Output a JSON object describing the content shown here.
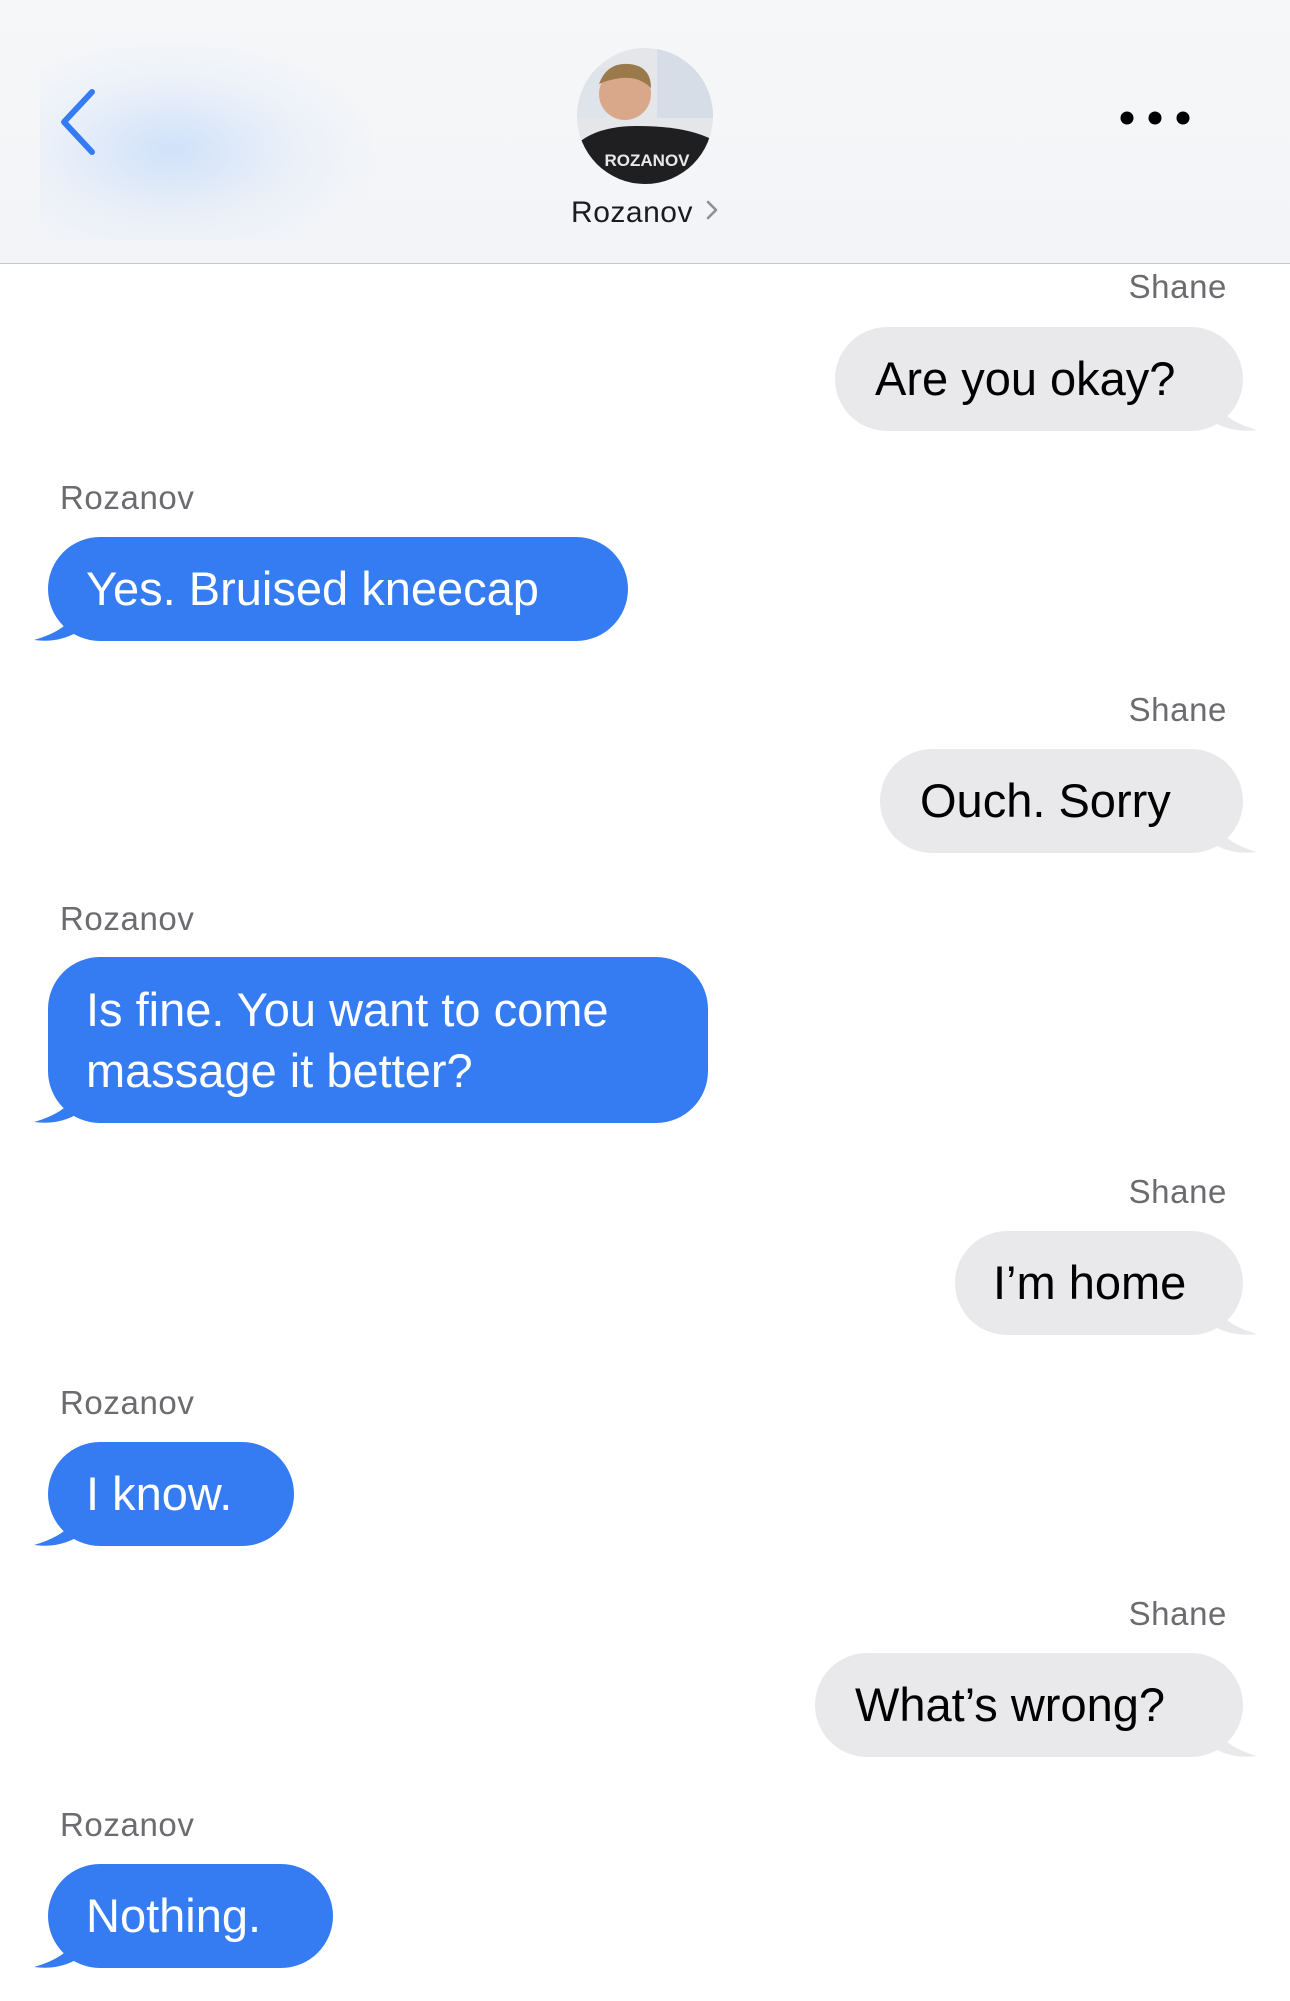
{
  "header": {
    "contact_name": "Rozanov",
    "avatar_jersey_text": "ROZANOV",
    "back_icon": "chevron-left-icon",
    "more_icon": "ellipsis-icon",
    "name_chevron_icon": "chevron-right-icon"
  },
  "colors": {
    "incoming_bubble": "#357cf2",
    "outgoing_bubble": "#e9e9eb",
    "accent": "#357cf2"
  },
  "messages": [
    {
      "sender": "Shane",
      "text": "Are you okay?",
      "direction": "outgoing"
    },
    {
      "sender": "Rozanov",
      "text": "Yes. Bruised kneecap",
      "direction": "incoming"
    },
    {
      "sender": "Shane",
      "text": "Ouch. Sorry",
      "direction": "outgoing"
    },
    {
      "sender": "Rozanov",
      "text": "Is fine. You want to come massage it better?",
      "direction": "incoming"
    },
    {
      "sender": "Shane",
      "text": "I’m home",
      "direction": "outgoing"
    },
    {
      "sender": "Rozanov",
      "text": "I know.",
      "direction": "incoming"
    },
    {
      "sender": "Shane",
      "text": "What’s wrong?",
      "direction": "outgoing"
    },
    {
      "sender": "Rozanov",
      "text": "Nothing.",
      "direction": "incoming"
    }
  ]
}
